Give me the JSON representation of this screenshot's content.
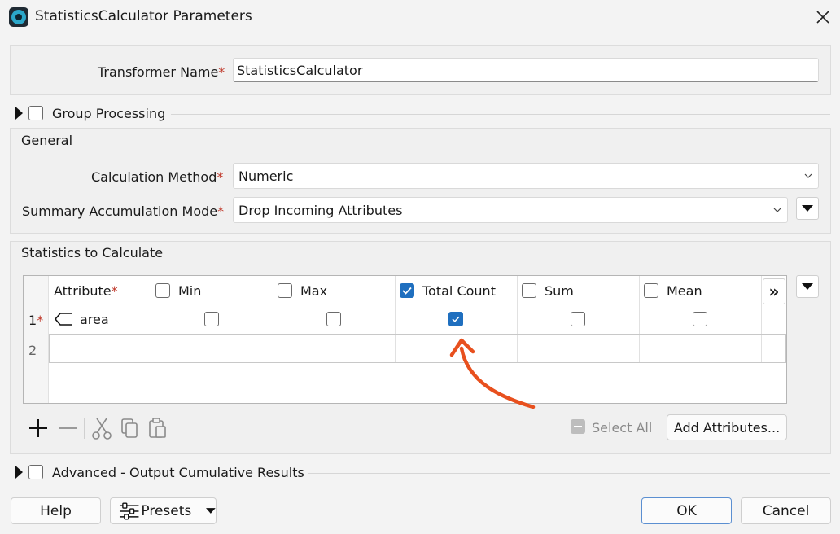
{
  "window": {
    "title": "StatisticsCalculator Parameters"
  },
  "transformer": {
    "label": "Transformer Name",
    "required": "*",
    "value": "StatisticsCalculator"
  },
  "group_processing": {
    "label": "Group Processing"
  },
  "general": {
    "section_label": "General",
    "calc_method": {
      "label": "Calculation Method",
      "required": "*",
      "value": "Numeric"
    },
    "summary_mode": {
      "label": "Summary Accumulation Mode",
      "required": "*",
      "value": "Drop Incoming Attributes"
    }
  },
  "stats": {
    "section_label": "Statistics to Calculate",
    "columns": {
      "attribute": "Attribute",
      "attribute_required": "*",
      "min": "Min",
      "max": "Max",
      "total_count": "Total Count",
      "sum": "Sum",
      "mean": "Mean"
    },
    "more_columns_label": "»",
    "rows": [
      {
        "num": "1",
        "required": "*",
        "attribute": "area",
        "min": false,
        "max": false,
        "total_count": true,
        "sum": false,
        "mean": false
      },
      {
        "num": "2"
      }
    ],
    "select_all_label": "Select All",
    "add_attributes_label": "Add Attributes..."
  },
  "advanced": {
    "label": "Advanced - Output Cumulative Results"
  },
  "footer": {
    "help": "Help",
    "presets": "Presets",
    "ok": "OK",
    "cancel": "Cancel"
  },
  "colors": {
    "accent": "#1f6fbf",
    "annotation_arrow": "#e8501e",
    "required": "#c0392b"
  }
}
